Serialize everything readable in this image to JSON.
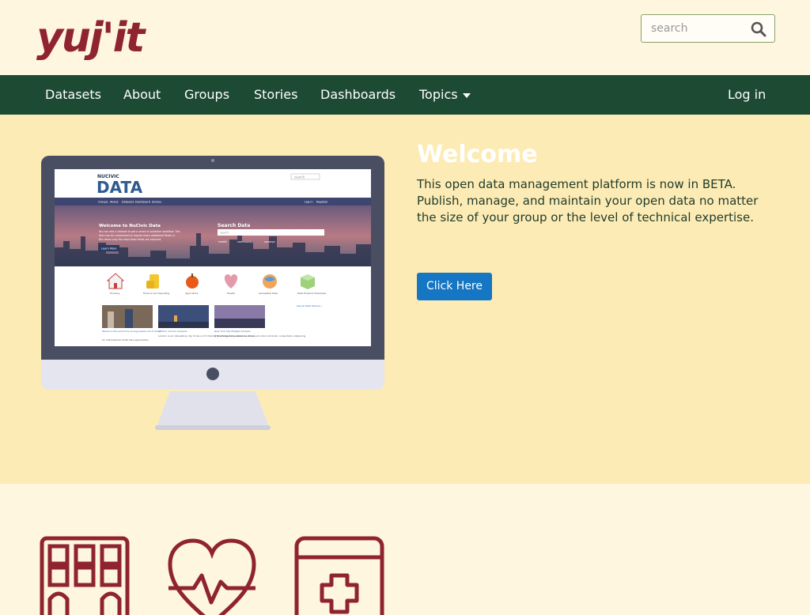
{
  "header": {
    "logo_text": "yuj'it",
    "search": {
      "placeholder": "search",
      "icon": "search-icon"
    }
  },
  "nav": {
    "items": [
      {
        "label": "Datasets"
      },
      {
        "label": "About"
      },
      {
        "label": "Groups"
      },
      {
        "label": "Stories"
      },
      {
        "label": "Dashboards"
      },
      {
        "label": "Topics",
        "icon": "caret-down-icon"
      }
    ],
    "login_label": "Log in"
  },
  "hero": {
    "title": "Welcome",
    "text": "This open data management platform is now in BETA. Publish, manage, and maintain your open data no matter the size of your group or the level of technical expertise.",
    "button_label": "Click Here",
    "screen": {
      "brand_small": "NUCIVIC",
      "brand_large": "DATA",
      "search_placeholder": "search",
      "nav": [
        "Groups",
        "About",
        "Datasets",
        "Dashboard",
        "Stories"
      ],
      "nav_right": [
        "Log in",
        "Register"
      ],
      "banner_title": "Welcome to NuCivic Data",
      "banner_text": "You can add a Dataset to get a sense of publisher workflow. This form can be customized to require many additional fields. In this demo only the most basic fields are required.",
      "banner_button": "Learn More",
      "search_title": "Search Data",
      "search_input": "search",
      "search_tags": [
        "health",
        "community",
        "surveys"
      ],
      "topics": [
        "Housing",
        "Finance and Spending",
        "Agriculture",
        "Health",
        "Geospatial Data",
        "Data Explorer Examples"
      ],
      "see_all": "See all Data Stories »",
      "stories": [
        {
          "title": "Where in the world are young people out of work?",
          "text": "An International Youth Day approaches"
        },
        {
          "title": "London Income Analysis",
          "text": "London is an interesting city. It has a rich history spanning many centuries. Over"
        },
        {
          "title": "New York City Budget Analysis",
          "text": "NYC's Budget Visualized, Lorem ipsum dolor sit amet, consectetur adipiscing"
        }
      ]
    }
  },
  "colors": {
    "brand": "#8f2430",
    "nav_bg": "#1d4a33",
    "hero_bg": "#fdebb5",
    "page_bg": "#fef6de",
    "button": "#1576c3"
  },
  "topics": [
    {
      "icon": "building-icon"
    },
    {
      "icon": "heart-pulse-icon"
    },
    {
      "icon": "medical-kit-icon"
    }
  ]
}
